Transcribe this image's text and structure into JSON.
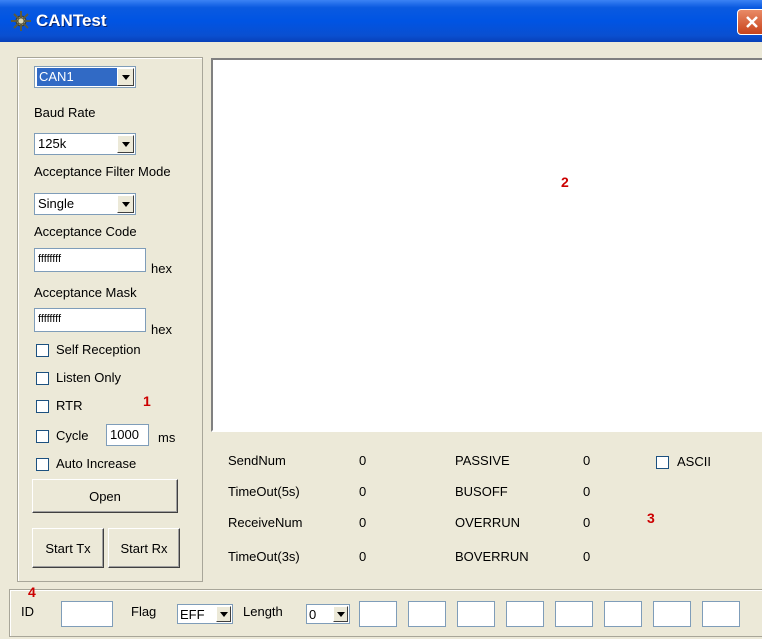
{
  "window": {
    "title": "CANTest"
  },
  "left_panel": {
    "channel": "CAN1",
    "baud_rate_label": "Baud Rate",
    "baud_rate_value": "125k",
    "filter_mode_label": "Acceptance Filter Mode",
    "filter_mode_value": "Single",
    "acceptance_code_label": "Acceptance Code",
    "acceptance_code_value": "ffffffff",
    "acceptance_code_unit": "hex",
    "acceptance_mask_label": "Acceptance Mask",
    "acceptance_mask_value": "ffffffff",
    "acceptance_mask_unit": "hex",
    "self_reception_label": "Self Reception",
    "listen_only_label": "Listen Only",
    "rtr_label": "RTR",
    "cycle_label": "Cycle",
    "cycle_value": "1000",
    "cycle_unit": "ms",
    "auto_increase_label": "Auto Increase",
    "open_label": "Open",
    "start_tx_label": "Start Tx",
    "start_rx_label": "Start Rx"
  },
  "markers": {
    "m1": "1",
    "m2": "2",
    "m3": "3",
    "m4": "4"
  },
  "stats": {
    "send_num_label": "SendNum",
    "send_num_value": "0",
    "timeout5_label": "TimeOut(5s)",
    "timeout5_value": "0",
    "receive_num_label": "ReceiveNum",
    "receive_num_value": "0",
    "timeout3_label": "TimeOut(3s)",
    "timeout3_value": "0",
    "passive_label": "PASSIVE",
    "passive_value": "0",
    "busoff_label": "BUSOFF",
    "busoff_value": "0",
    "overrun_label": "OVERRUN",
    "overrun_value": "0",
    "boverrun_label": "BOVERRUN",
    "boverrun_value": "0",
    "ascii_label": "ASCII"
  },
  "bottom": {
    "id_label": "ID",
    "id_value": "",
    "flag_label": "Flag",
    "flag_value": "EFF",
    "length_label": "Length",
    "length_value": "0"
  }
}
